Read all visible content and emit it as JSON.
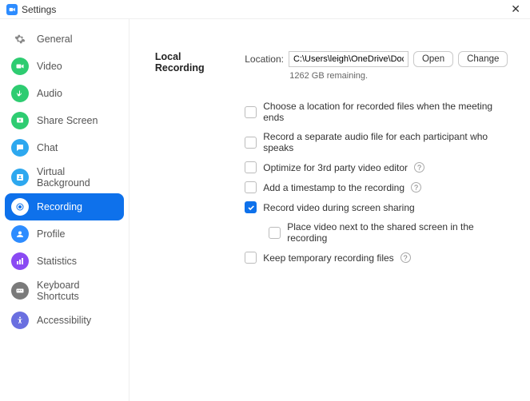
{
  "window": {
    "title": "Settings"
  },
  "sidebar": {
    "items": [
      {
        "label": "General",
        "icon": "gear",
        "color": "#d8d8d8"
      },
      {
        "label": "Video",
        "icon": "video",
        "color": "#2ecc71"
      },
      {
        "label": "Audio",
        "icon": "audio",
        "color": "#2ecc71"
      },
      {
        "label": "Share Screen",
        "icon": "share",
        "color": "#2ecc71"
      },
      {
        "label": "Chat",
        "icon": "chat",
        "color": "#2da8ef"
      },
      {
        "label": "Virtual Background",
        "icon": "vbg",
        "color": "#2da8ef"
      },
      {
        "label": "Recording",
        "icon": "record",
        "color": "#0e71eb",
        "active": true
      },
      {
        "label": "Profile",
        "icon": "profile",
        "color": "#2d8cff"
      },
      {
        "label": "Statistics",
        "icon": "stats",
        "color": "#8a4af3"
      },
      {
        "label": "Keyboard Shortcuts",
        "icon": "keyboard",
        "color": "#7a7a7a"
      },
      {
        "label": "Accessibility",
        "icon": "accessibility",
        "color": "#6a6fe0"
      }
    ]
  },
  "recording": {
    "section_title": "Local Recording",
    "location_label": "Location:",
    "location_value": "C:\\Users\\leigh\\OneDrive\\Docum",
    "open_label": "Open",
    "change_label": "Change",
    "remaining_text": "1262 GB remaining.",
    "options": [
      {
        "label": "Choose a location for recorded files when the meeting ends",
        "checked": false,
        "help": false
      },
      {
        "label": "Record a separate audio file for each participant who speaks",
        "checked": false,
        "help": false
      },
      {
        "label": "Optimize for 3rd party video editor",
        "checked": false,
        "help": true
      },
      {
        "label": "Add a timestamp to the recording",
        "checked": false,
        "help": true
      },
      {
        "label": "Record video during screen sharing",
        "checked": true,
        "help": false
      },
      {
        "label": "Place video next to the shared screen in the recording",
        "checked": false,
        "help": false,
        "sub": true
      },
      {
        "label": "Keep temporary recording files",
        "checked": false,
        "help": true
      }
    ]
  }
}
